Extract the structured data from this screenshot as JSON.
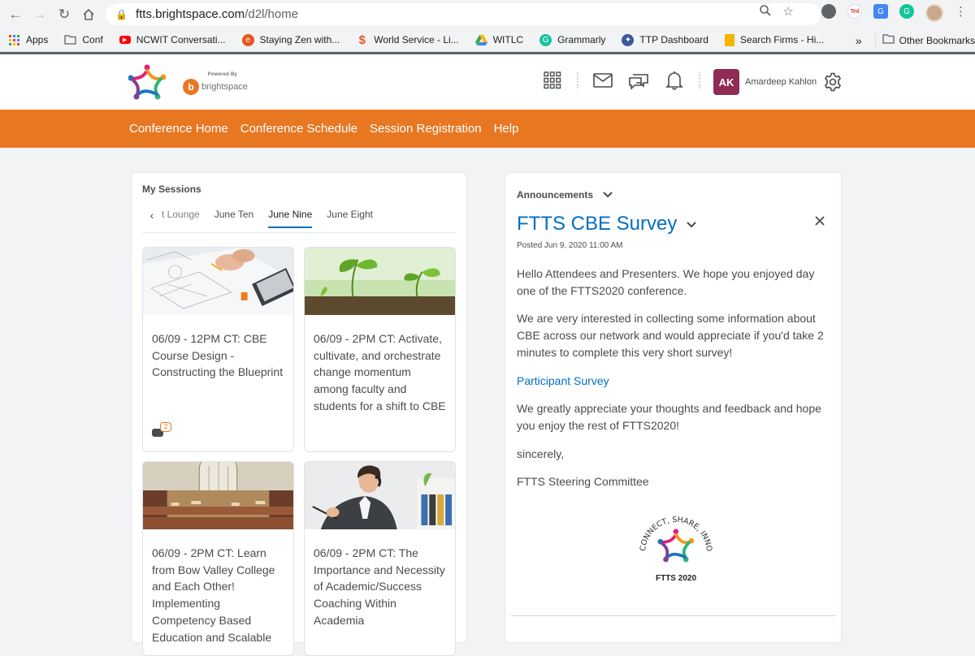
{
  "browser": {
    "url_host": "ftts.brightspace.com",
    "url_path": "/d2l/home",
    "bookmarks": [
      {
        "label": "Apps",
        "color": "#4285f4"
      },
      {
        "label": "Conf",
        "color": "#5f6368"
      },
      {
        "label": "NCWIT Conversati...",
        "color": "#ff0000"
      },
      {
        "label": "Staying Zen with...",
        "color": "#e8571e"
      },
      {
        "label": "World Service - Li...",
        "color": "#e8571e"
      },
      {
        "label": "WITLC",
        "color": "#34a853"
      },
      {
        "label": "Grammarly",
        "color": "#15c39a"
      },
      {
        "label": "TTP Dashboard",
        "color": "#3b5998"
      },
      {
        "label": "Search Firms - Hi...",
        "color": "#f4b400"
      }
    ],
    "more_bookmarks": "»",
    "other_bookmarks": "Other Bookmarks"
  },
  "header": {
    "powered_by": "Powered By",
    "brand": "brightspace",
    "avatar_initials": "AK",
    "user_name": "Amardeep Kahlon",
    "colors": {
      "avatar": "#8f2b54",
      "accent": "#e87722",
      "link": "#006fbf"
    }
  },
  "nav": {
    "items": [
      "Conference Home",
      "Conference Schedule",
      "Session Registration",
      "Help"
    ]
  },
  "sessions": {
    "title": "My Sessions",
    "tabs": [
      "t Lounge",
      "June Ten",
      "June Nine",
      "June Eight"
    ],
    "active_tab": "June Nine",
    "cards": [
      {
        "title": "06/09 - 12PM CT: CBE Course Design - Constructing the Blueprint",
        "comments": "2"
      },
      {
        "title": "06/09 - 2PM CT: Activate, cultivate, and orchestrate change momentum among faculty and students for a shift to CBE"
      },
      {
        "title": "06/09 - 2PM CT: Learn from Bow Valley College and Each Other! Implementing Competency Based Education and Scalable"
      },
      {
        "title": "06/09 - 2PM CT: The Importance and Necessity of Academic/Success Coaching Within Academia"
      }
    ]
  },
  "announcements": {
    "header": "Announcements",
    "title": "FTTS CBE Survey",
    "posted": "Posted Jun 9, 2020 11:00 AM",
    "para1": "Hello Attendees and Presenters.  We hope you enjoyed day one of the FTTS2020 conference.",
    "para2": "We are very interested in collecting some information about CBE across our network and would appreciate if you'd take 2 minutes to complete this very short survey!",
    "link": "Participant Survey",
    "para3": "We greatly appreciate your thoughts and feedback and hope you enjoy the rest of FTTS2020!",
    "sign1": "sincerely,",
    "sign2": "FTTS Steering Committee",
    "logo_text": "CONNECT, SHARE, INNOVATE!",
    "logo_caption": "FTTS 2020"
  }
}
